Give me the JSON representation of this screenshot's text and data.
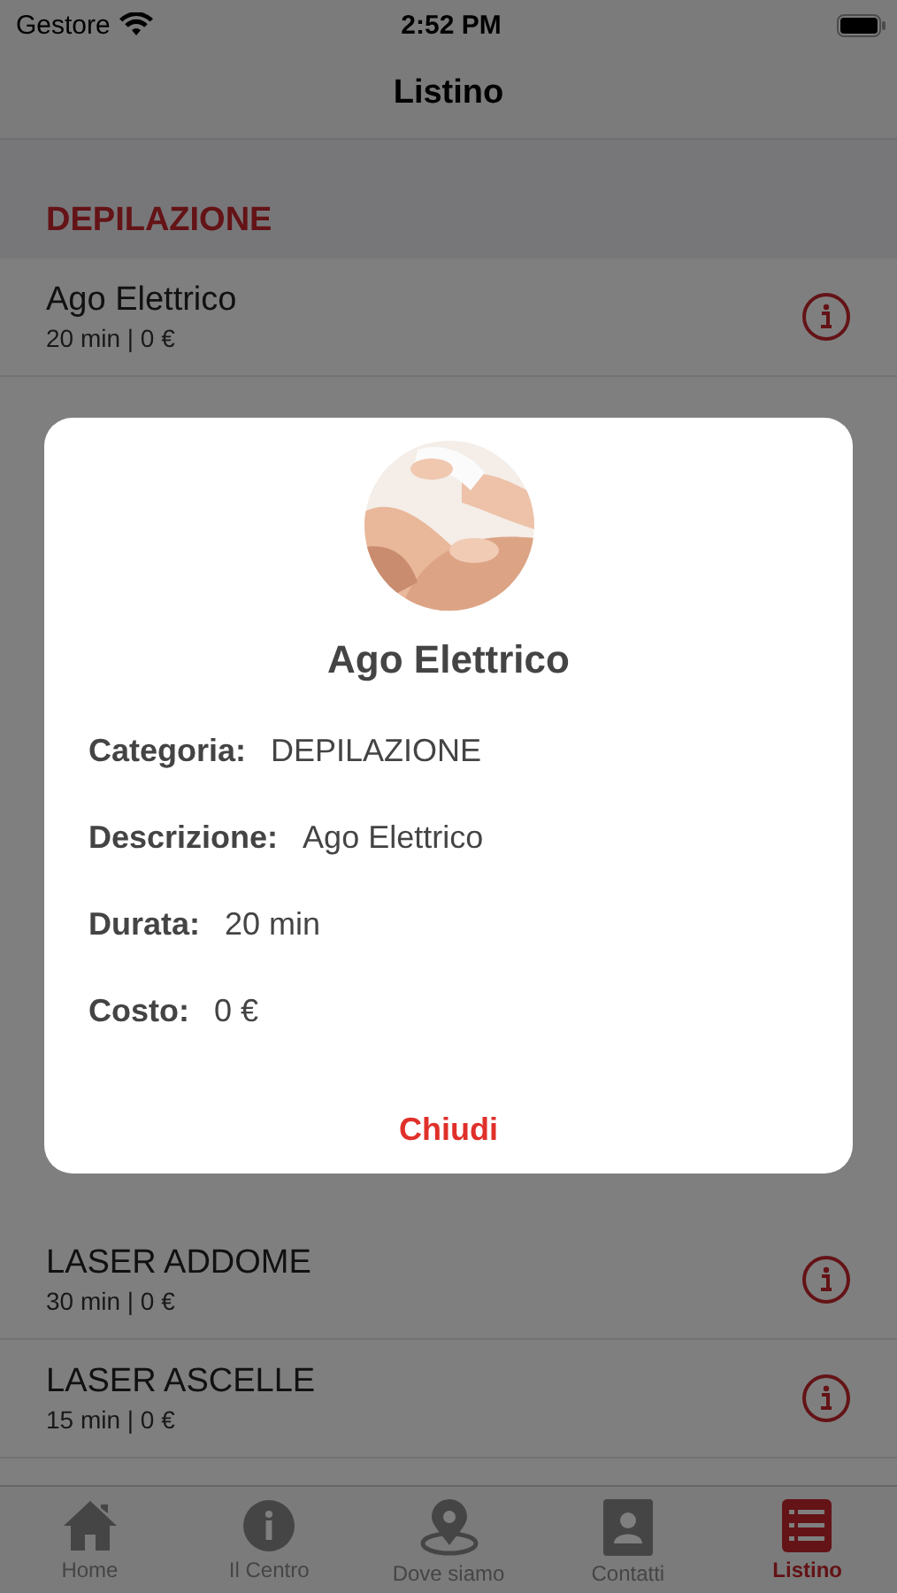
{
  "status_bar": {
    "carrier": "Gestore",
    "time": "2:52 PM"
  },
  "nav": {
    "title": "Listino"
  },
  "section": {
    "title": "DEPILAZIONE"
  },
  "items_top": [
    {
      "name": "Ago Elettrico",
      "detail": "20 min | 0 €"
    }
  ],
  "items_bottom": [
    {
      "name": "LASER ADDOME",
      "detail": "30 min | 0 €"
    },
    {
      "name": "LASER ASCELLE",
      "detail": "15 min | 0 €"
    }
  ],
  "dialog": {
    "title": "Ago Elettrico",
    "fields": [
      {
        "label": "Categoria:",
        "value": "DEPILAZIONE"
      },
      {
        "label": "Descrizione:",
        "value": "Ago Elettrico"
      },
      {
        "label": "Durata:",
        "value": "20 min"
      },
      {
        "label": "Costo:",
        "value": "0 €"
      }
    ],
    "button": "Chiudi"
  },
  "tabs": [
    {
      "kind": "home",
      "label": "Home",
      "selected": false
    },
    {
      "kind": "info",
      "label": "Il Centro",
      "selected": false
    },
    {
      "kind": "pin",
      "label": "Dove siamo",
      "selected": false
    },
    {
      "kind": "contact",
      "label": "Contatti",
      "selected": false
    },
    {
      "kind": "list",
      "label": "Listino",
      "selected": true
    }
  ]
}
